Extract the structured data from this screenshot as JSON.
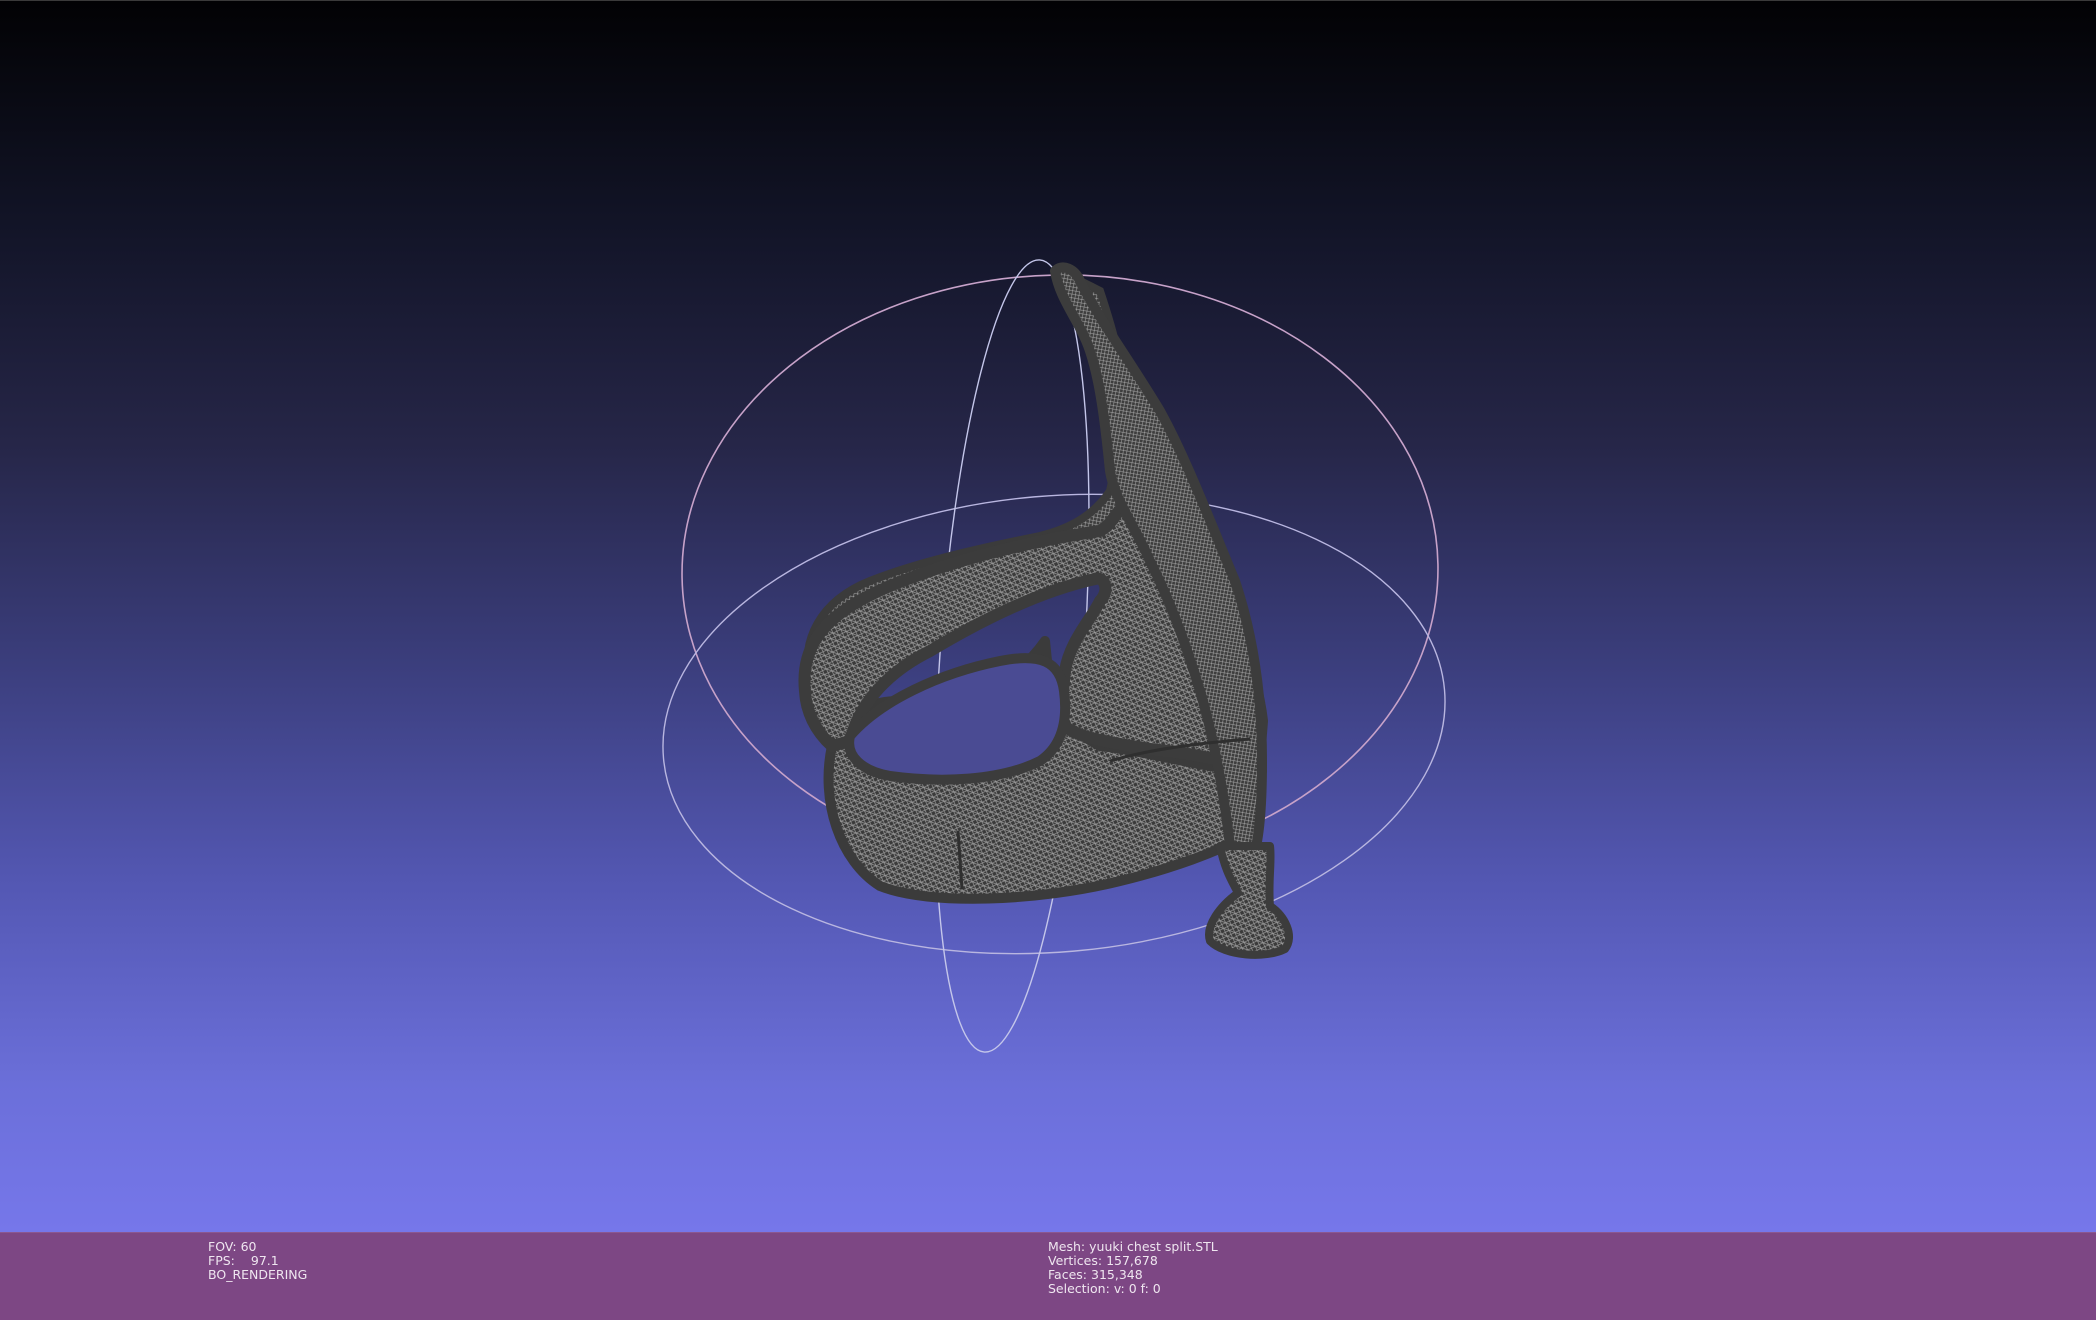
{
  "window": {
    "title": ""
  },
  "viewport": {
    "background_top": "#020204",
    "background_bottom": "#7677ea",
    "mesh_color": "#3c3c3c",
    "trackball_colors": [
      "#c7a2c9",
      "#b9b6e0",
      "#c4c6ea"
    ]
  },
  "info_left": {
    "fov_label": "FOV:",
    "fov_value": "60",
    "fps_label": "FPS:",
    "fps_value": "97.1",
    "mode": "BO_RENDERING"
  },
  "info_right": {
    "mesh_label": "Mesh:",
    "mesh_value": "yuuki chest split.STL",
    "vertices_label": "Vertices:",
    "vertices_value": "157,678",
    "faces_label": "Faces:",
    "faces_value": "315,348",
    "selection_label": "Selection:",
    "selection_value": "v: 0 f: 0"
  },
  "info_bar_color": "#7d4784"
}
